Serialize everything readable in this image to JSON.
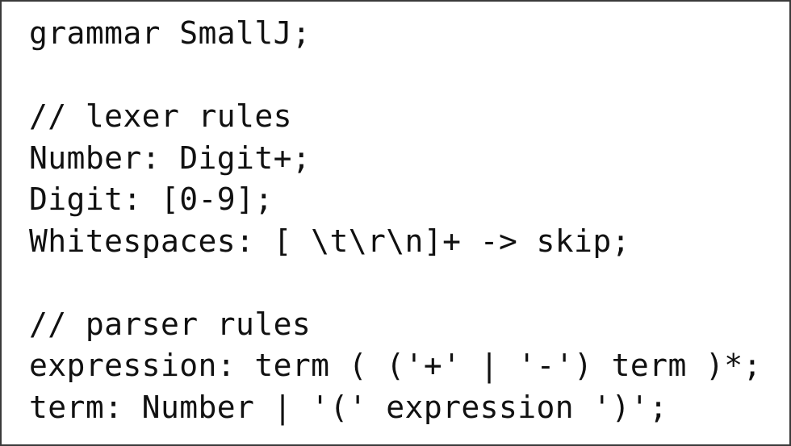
{
  "document": {
    "lines": [
      "grammar SmallJ;",
      "",
      "// lexer rules",
      "Number: Digit+;",
      "Digit: [0-9];",
      "Whitespaces: [ \\t\\r\\n]+ -> skip;",
      "",
      "// parser rules",
      "expression: term ( ('+' | '-') term )*;",
      "term: Number | '(' expression ')';"
    ]
  },
  "colors": {
    "text": "#111111",
    "border": "#3a3a3a",
    "background": "#ffffff"
  }
}
